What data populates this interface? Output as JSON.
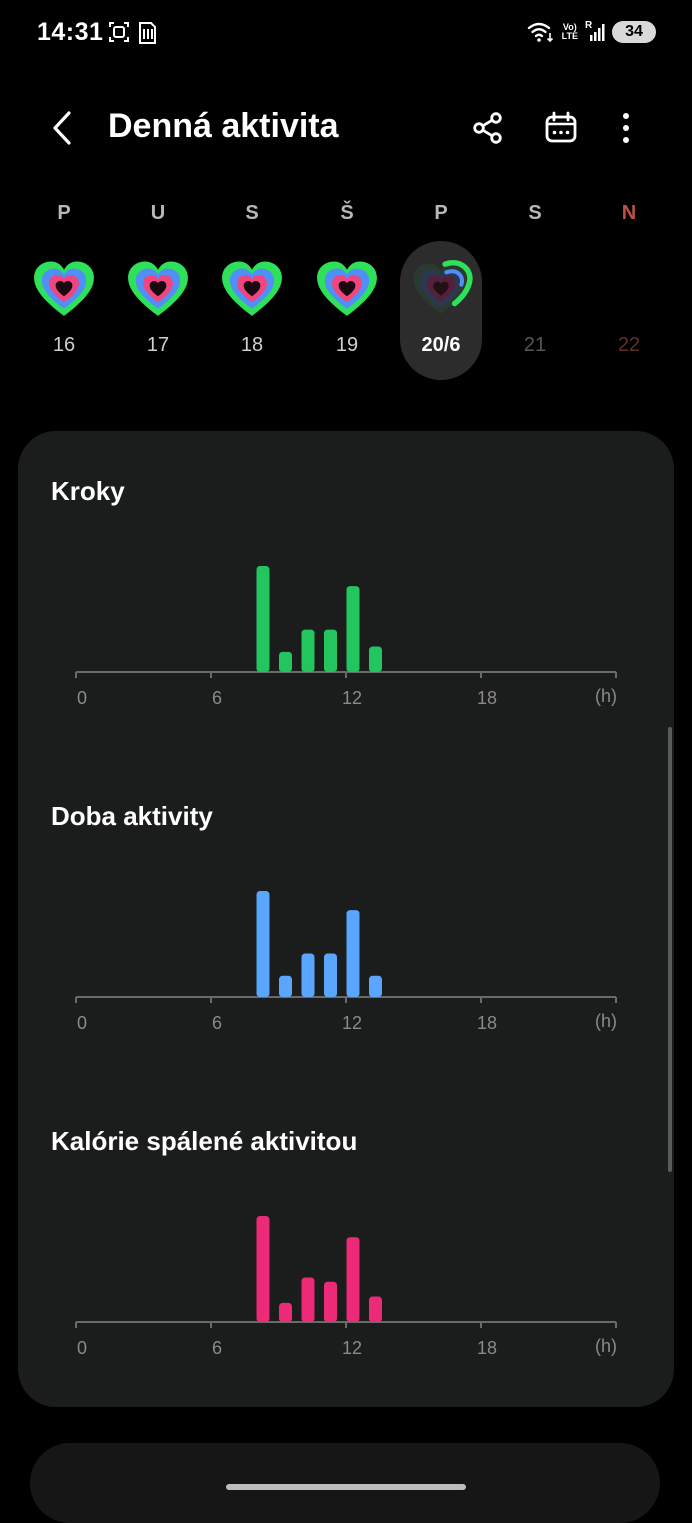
{
  "status_bar": {
    "time": "14:31",
    "left_icons": [
      "screenshot-icon",
      "sim-card-icon"
    ],
    "right_icons": [
      "wifi-icon",
      "volte-icon",
      "signal-icon"
    ],
    "volte_text_top": "Vo)",
    "volte_text_bottom": "LTE",
    "roaming_text": "R",
    "battery": "34"
  },
  "header": {
    "title": "Denná aktivita",
    "actions": [
      "back-icon",
      "share-icon",
      "calendar-icon",
      "more-icon"
    ]
  },
  "week": [
    {
      "letter": "P",
      "date": "16",
      "state": "past"
    },
    {
      "letter": "U",
      "date": "17",
      "state": "past"
    },
    {
      "letter": "S",
      "date": "18",
      "state": "past"
    },
    {
      "letter": "Š",
      "date": "19",
      "state": "past"
    },
    {
      "letter": "P",
      "date": "20/6",
      "state": "selected"
    },
    {
      "letter": "S",
      "date": "21",
      "state": "future"
    },
    {
      "letter": "N",
      "date": "22",
      "state": "future-sunday"
    }
  ],
  "colors": {
    "steps": "#22c55e",
    "active_time": "#5aa6ff",
    "calories": "#ec2a78",
    "ring_green": "#2ee05a",
    "ring_blue": "#4f8ff7",
    "ring_pink": "#f0457e",
    "sunday": "#c0513e"
  },
  "sections": [
    {
      "title": "Kroky"
    },
    {
      "title": "Doba aktivity"
    },
    {
      "title": "Kalórie spálené aktivitou"
    }
  ],
  "chart_data": [
    {
      "type": "bar",
      "title": "Kroky",
      "x_ticks": [
        "0",
        "6",
        "12",
        "18"
      ],
      "unit": "(h)",
      "xlim": [
        0,
        24
      ],
      "x": [
        8,
        9,
        10,
        11,
        12,
        13
      ],
      "values": [
        1.0,
        0.19,
        0.4,
        0.4,
        0.81,
        0.24
      ],
      "color": "#22c55e"
    },
    {
      "type": "bar",
      "title": "Doba aktivity",
      "x_ticks": [
        "0",
        "6",
        "12",
        "18"
      ],
      "unit": "(h)",
      "xlim": [
        0,
        24
      ],
      "x": [
        8,
        9,
        10,
        11,
        12,
        13
      ],
      "values": [
        1.0,
        0.2,
        0.41,
        0.41,
        0.82,
        0.2
      ],
      "color": "#5aa6ff"
    },
    {
      "type": "bar",
      "title": "Kalórie spálené aktivitou",
      "x_ticks": [
        "0",
        "6",
        "12",
        "18"
      ],
      "unit": "(h)",
      "xlim": [
        0,
        24
      ],
      "x": [
        8,
        9,
        10,
        11,
        12,
        13
      ],
      "values": [
        1.0,
        0.18,
        0.42,
        0.38,
        0.8,
        0.24
      ],
      "color": "#ec2a78"
    }
  ]
}
